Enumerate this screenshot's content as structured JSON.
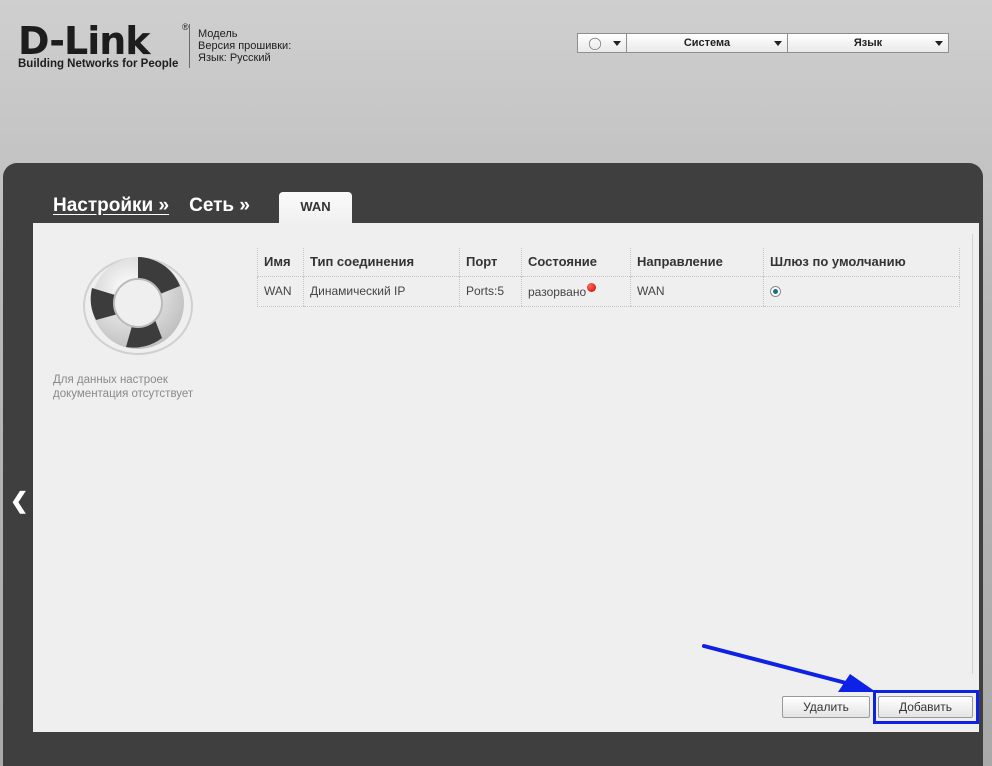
{
  "header": {
    "logo": "D-Link",
    "logo_tagline": "Building Networks for People",
    "info": {
      "model_label": "Модель",
      "firmware_label": "Версия прошивки:",
      "language_line": "Язык: Русский"
    },
    "menu": {
      "hint_icon": "lightbulb-icon",
      "system_label": "Система",
      "language_label": "Язык"
    }
  },
  "breadcrumb": {
    "item1": "Настройки »",
    "item2": "Сеть »",
    "current_tab": "WAN"
  },
  "help": {
    "icon": "lifebuoy-icon",
    "text": "Для данных настроек документация отсутствует"
  },
  "table": {
    "columns": [
      "Имя",
      "Тип соединения",
      "Порт",
      "Состояние",
      "Направление",
      "Шлюз по умолчанию"
    ],
    "rows": [
      {
        "name": "WAN",
        "type": "Динамический IP",
        "port": "Ports:5",
        "state": "разорвано",
        "direction": "WAN",
        "default_gateway": true
      }
    ]
  },
  "buttons": {
    "delete": "Удалить",
    "add": "Добавить"
  },
  "colors": {
    "highlight": "#0e22e6",
    "frame": "#3f3f3f",
    "panel": "#efefef",
    "status_disconnected": "#c80000"
  }
}
